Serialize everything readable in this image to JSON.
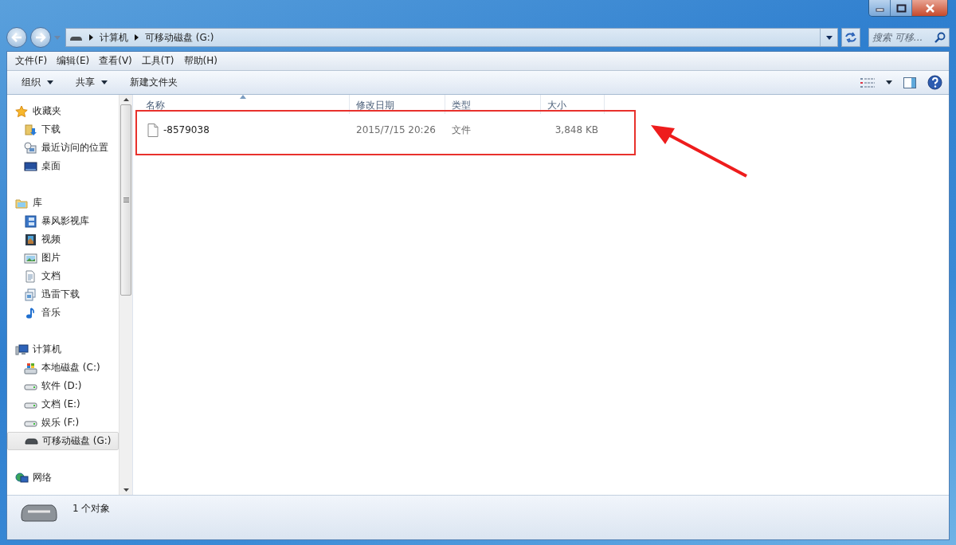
{
  "address": {
    "crumbs": [
      "计算机",
      "可移动磁盘 (G:)"
    ]
  },
  "search": {
    "placeholder": "搜索 可移..."
  },
  "menu": [
    "文件(F)",
    "编辑(E)",
    "查看(V)",
    "工具(T)",
    "帮助(H)"
  ],
  "toolbar": [
    {
      "label": "组织",
      "has_menu": true
    },
    {
      "label": "共享",
      "has_menu": true
    },
    {
      "label": "新建文件夹",
      "has_menu": false
    }
  ],
  "nav": [
    {
      "label": "收藏夹",
      "kind": "star",
      "selected": false,
      "children": [
        {
          "label": "下载",
          "kind": "download",
          "selected": false
        },
        {
          "label": "最近访问的位置",
          "kind": "recent",
          "selected": false
        },
        {
          "label": "桌面",
          "kind": "desktop",
          "selected": false
        }
      ]
    },
    {
      "label": "库",
      "kind": "library",
      "selected": false,
      "children": [
        {
          "label": "暴风影视库",
          "kind": "media",
          "selected": false
        },
        {
          "label": "视频",
          "kind": "video",
          "selected": false
        },
        {
          "label": "图片",
          "kind": "pictures",
          "selected": false
        },
        {
          "label": "文档",
          "kind": "document",
          "selected": false
        },
        {
          "label": "迅雷下载",
          "kind": "copy",
          "selected": false
        },
        {
          "label": "音乐",
          "kind": "music",
          "selected": false
        }
      ]
    },
    {
      "label": "计算机",
      "kind": "computer",
      "selected": false,
      "children": [
        {
          "label": "本地磁盘 (C:)",
          "kind": "system-drive",
          "selected": false
        },
        {
          "label": "软件 (D:)",
          "kind": "drive",
          "selected": false
        },
        {
          "label": "文档 (E:)",
          "kind": "drive",
          "selected": false
        },
        {
          "label": "娱乐 (F:)",
          "kind": "drive",
          "selected": false
        },
        {
          "label": "可移动磁盘 (G:)",
          "kind": "usb",
          "selected": true
        }
      ]
    },
    {
      "label": "网络",
      "kind": "network",
      "selected": false
    }
  ],
  "columns": [
    {
      "label": "名称",
      "sorted": true
    },
    {
      "label": "修改日期",
      "sorted": false
    },
    {
      "label": "类型",
      "sorted": false
    },
    {
      "label": "大小",
      "sorted": false
    }
  ],
  "rows": [
    {
      "name": "-8579038",
      "date": "2015/7/15 20:26",
      "type": "文件",
      "size": "3,848 KB",
      "highlighted": true
    }
  ],
  "callout_arrow": true,
  "status": {
    "text": "1 个对象"
  }
}
